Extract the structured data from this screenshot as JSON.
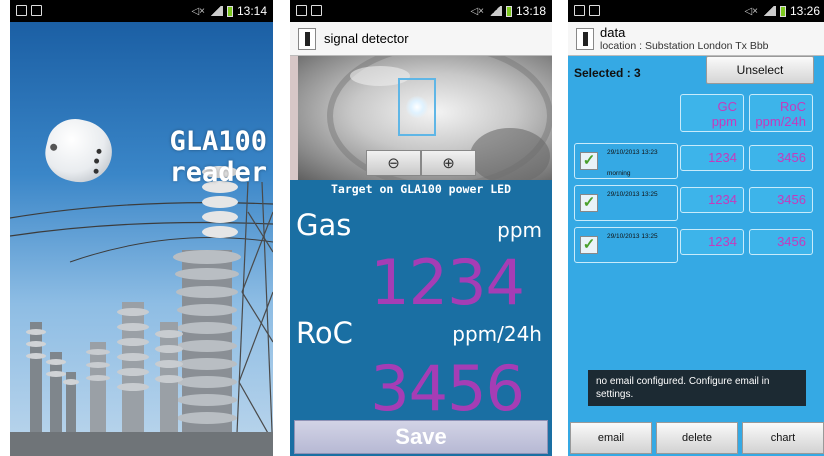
{
  "screens": [
    {
      "time": "13:14",
      "splash_line1": "GLA100",
      "splash_line2": "reader"
    },
    {
      "time": "13:18",
      "title": "signal detector",
      "zoom_out_icon": "zoom-out-icon",
      "zoom_in_icon": "zoom-in-icon",
      "target_text": "Target on GLA100 power LED",
      "gas_label": "Gas",
      "gas_unit": "ppm",
      "gas_value": "1234",
      "roc_label": "RoC",
      "roc_unit": "ppm/24h",
      "roc_value": "3456",
      "save_label": "Save"
    },
    {
      "time": "13:26",
      "title": "data",
      "location": "location : Substation London Tx Bbb",
      "selected": "Selected : 3",
      "unselect_label": "Unselect",
      "header_gc": [
        "GC",
        "ppm"
      ],
      "header_roc": [
        "RoC",
        "ppm/24h"
      ],
      "rows": [
        {
          "date": "29/10/2013 13:23",
          "note": "morning",
          "gc": "1234",
          "roc": "3456",
          "checked": true
        },
        {
          "date": "29/10/2013 13:25",
          "note": "",
          "gc": "1234",
          "roc": "3456",
          "checked": true
        },
        {
          "date": "29/10/2013 13:25",
          "note": "",
          "gc": "1234",
          "roc": "3456",
          "checked": true
        }
      ],
      "toast": "no email configured. Configure email in settings.",
      "buttons": [
        "email",
        "delete",
        "chart"
      ]
    }
  ],
  "colors": {
    "value_purple": "#a53db5",
    "table_text": "#c43bbd",
    "screen2_bg": "#1a6fa3",
    "screen3_bg": "#35a9e4"
  }
}
